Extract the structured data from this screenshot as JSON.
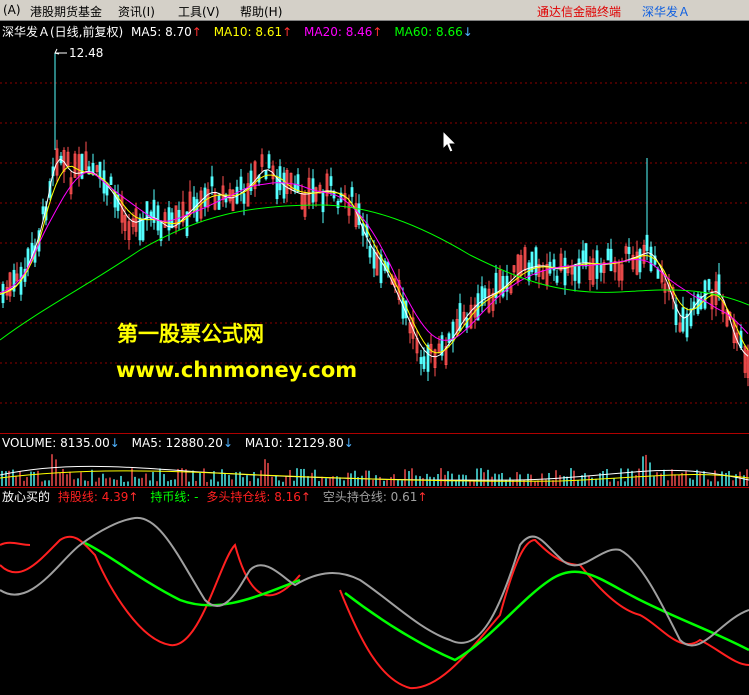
{
  "menu": {
    "items": [
      "(A)",
      "港股期货基金",
      "资讯(I)",
      "工具(V)",
      "帮助(H)"
    ],
    "broker": "通达信金融终端",
    "stock": "深华发Ａ"
  },
  "main_panel": {
    "title": "深华发Ａ(日线,前复权)",
    "ma5": "MA5: 8.70",
    "ma10": "MA10: 8.61",
    "ma20": "MA20: 8.46",
    "ma60": "MA60: 8.66",
    "high_label": "12.48",
    "colors": {
      "ma5": "#ffffff",
      "ma10": "#ffff00",
      "ma20": "#ff00ff",
      "ma60": "#00ff00",
      "up": "#ff5050",
      "down": "#54ffff"
    }
  },
  "volume_panel": {
    "volume": "VOLUME: 8135.00",
    "ma5": "MA5: 12880.20",
    "ma10": "MA10: 12129.80"
  },
  "indicator_panel": {
    "name": "放心买的",
    "hold_stock": "持股线: 4.39",
    "hold_cash": "持币线: -",
    "long_pos": "多头持仓线: 8.16",
    "short_pos": "空头持仓线: 0.61",
    "colors": {
      "hold_stock": "#ff2020",
      "hold_cash": "#00ff00",
      "long_pos": "#ff2020",
      "short_pos": "#a0a0a0"
    }
  },
  "watermark": {
    "cn": "第一股票公式网",
    "en": "www.chnmoney.com"
  }
}
